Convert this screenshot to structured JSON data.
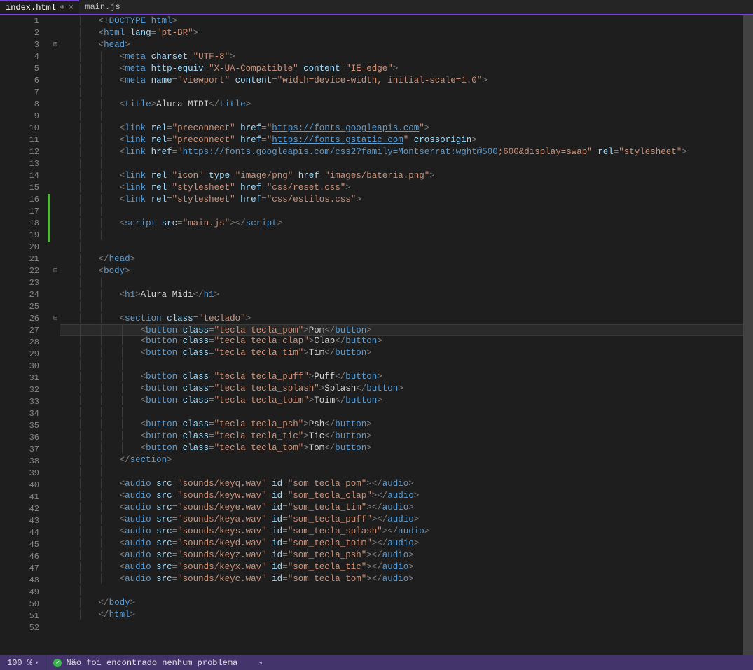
{
  "tabs": [
    {
      "label": "index.html",
      "active": true,
      "pinned": true,
      "closeable": true
    },
    {
      "label": "main.js",
      "active": false
    }
  ],
  "status": {
    "zoom": "100 %",
    "problems_text": "Não foi encontrado nenhum problema"
  },
  "current_line": 27,
  "lines": [
    {
      "n": 1,
      "t": [
        "<!",
        "DOCTYPE",
        " html",
        ">"
      ],
      "c": [
        "pun",
        "doctype",
        "tag",
        "pun"
      ],
      "i": 2
    },
    {
      "n": 2,
      "t": [
        "<",
        "html",
        " lang",
        "=",
        "\"pt-BR\"",
        ">"
      ],
      "c": [
        "pun",
        "tag",
        "attr",
        "pun",
        "str",
        "pun"
      ],
      "i": 2
    },
    {
      "n": 3,
      "t": [
        "<",
        "head",
        ">"
      ],
      "c": [
        "pun",
        "tag",
        "pun"
      ],
      "i": 2,
      "fold": "⊟"
    },
    {
      "n": 4,
      "t": [
        "<",
        "meta",
        " charset",
        "=",
        "\"UTF-8\"",
        ">"
      ],
      "c": [
        "pun",
        "tag",
        "attr",
        "pun",
        "str",
        "pun"
      ],
      "i": 3
    },
    {
      "n": 5,
      "t": [
        "<",
        "meta",
        " http-equiv",
        "=",
        "\"X-UA-Compatible\"",
        " content",
        "=",
        "\"IE=edge\"",
        ">"
      ],
      "c": [
        "pun",
        "tag",
        "attr",
        "pun",
        "str",
        "attr",
        "pun",
        "str",
        "pun"
      ],
      "i": 3
    },
    {
      "n": 6,
      "t": [
        "<",
        "meta",
        " name",
        "=",
        "\"viewport\"",
        " content",
        "=",
        "\"width=device-width, initial-scale=1.0\"",
        ">"
      ],
      "c": [
        "pun",
        "tag",
        "attr",
        "pun",
        "str",
        "attr",
        "pun",
        "str",
        "pun"
      ],
      "i": 3
    },
    {
      "n": 7,
      "t": [
        ""
      ],
      "c": [
        "txt"
      ],
      "i": 3
    },
    {
      "n": 8,
      "t": [
        "<",
        "title",
        ">",
        "Alura MIDI",
        "</",
        "title",
        ">"
      ],
      "c": [
        "pun",
        "tag",
        "pun",
        "txt",
        "pun",
        "tag",
        "pun"
      ],
      "i": 3
    },
    {
      "n": 9,
      "t": [
        ""
      ],
      "c": [
        "txt"
      ],
      "i": 3
    },
    {
      "n": 10,
      "t": [
        "<",
        "link",
        " rel",
        "=",
        "\"preconnect\"",
        " href",
        "=",
        "\"",
        "https://fonts.googleapis.com",
        "\"",
        ">"
      ],
      "c": [
        "pun",
        "tag",
        "attr",
        "pun",
        "str",
        "attr",
        "pun",
        "str",
        "url",
        "str",
        "pun"
      ],
      "i": 3
    },
    {
      "n": 11,
      "t": [
        "<",
        "link",
        " rel",
        "=",
        "\"preconnect\"",
        " href",
        "=",
        "\"",
        "https://fonts.gstatic.com",
        "\"",
        " crossorigin",
        ">"
      ],
      "c": [
        "pun",
        "tag",
        "attr",
        "pun",
        "str",
        "attr",
        "pun",
        "str",
        "url",
        "str",
        "attr",
        "pun"
      ],
      "i": 3
    },
    {
      "n": 12,
      "t": [
        "<",
        "link",
        " href",
        "=",
        "\"",
        "https://fonts.googleapis.com/css2?family=Montserrat:wght@500",
        ";600&display=swap\"",
        " rel",
        "=",
        "\"stylesheet\"",
        ">"
      ],
      "c": [
        "pun",
        "tag",
        "attr",
        "pun",
        "str",
        "url",
        "str",
        "attr",
        "pun",
        "str",
        "pun"
      ],
      "i": 3
    },
    {
      "n": 13,
      "t": [
        ""
      ],
      "c": [
        "txt"
      ],
      "i": 3
    },
    {
      "n": 14,
      "t": [
        "<",
        "link",
        " rel",
        "=",
        "\"icon\"",
        " type",
        "=",
        "\"image/png\"",
        " href",
        "=",
        "\"images/bateria.png\"",
        ">"
      ],
      "c": [
        "pun",
        "tag",
        "attr",
        "pun",
        "str",
        "attr",
        "pun",
        "str",
        "attr",
        "pun",
        "str",
        "pun"
      ],
      "i": 3
    },
    {
      "n": 15,
      "t": [
        "<",
        "link",
        " rel",
        "=",
        "\"stylesheet\"",
        " href",
        "=",
        "\"css/reset.css\"",
        ">"
      ],
      "c": [
        "pun",
        "tag",
        "attr",
        "pun",
        "str",
        "attr",
        "pun",
        "str",
        "pun"
      ],
      "i": 3
    },
    {
      "n": 16,
      "t": [
        "<",
        "link",
        " rel",
        "=",
        "\"stylesheet\"",
        " href",
        "=",
        "\"css/estilos.css\"",
        ">"
      ],
      "c": [
        "pun",
        "tag",
        "attr",
        "pun",
        "str",
        "attr",
        "pun",
        "str",
        "pun"
      ],
      "i": 3,
      "added": true
    },
    {
      "n": 17,
      "t": [
        ""
      ],
      "c": [
        "txt"
      ],
      "i": 3,
      "added": true
    },
    {
      "n": 18,
      "t": [
        "<",
        "script",
        " src",
        "=",
        "\"main.js\"",
        ">",
        "</",
        "script",
        ">"
      ],
      "c": [
        "pun",
        "tag",
        "attr",
        "pun",
        "str",
        "pun",
        "pun",
        "tag",
        "pun"
      ],
      "i": 3,
      "added": true
    },
    {
      "n": 19,
      "t": [
        ""
      ],
      "c": [
        "txt"
      ],
      "i": 3,
      "added": true
    },
    {
      "n": 20,
      "t": [
        ""
      ],
      "c": [
        "txt"
      ],
      "i": 2
    },
    {
      "n": 21,
      "t": [
        "</",
        "head",
        ">"
      ],
      "c": [
        "pun",
        "tag",
        "pun"
      ],
      "i": 2
    },
    {
      "n": 22,
      "t": [
        "<",
        "body",
        ">"
      ],
      "c": [
        "pun",
        "tag",
        "pun"
      ],
      "i": 2,
      "fold": "⊟"
    },
    {
      "n": 23,
      "t": [
        ""
      ],
      "c": [
        "txt"
      ],
      "i": 3
    },
    {
      "n": 24,
      "t": [
        "<",
        "h1",
        ">",
        "Alura Midi",
        "</",
        "h1",
        ">"
      ],
      "c": [
        "pun",
        "tag",
        "pun",
        "txt",
        "pun",
        "tag",
        "pun"
      ],
      "i": 3
    },
    {
      "n": 25,
      "t": [
        ""
      ],
      "c": [
        "txt"
      ],
      "i": 3
    },
    {
      "n": 26,
      "t": [
        "<",
        "section",
        " class",
        "=",
        "\"teclado\"",
        ">"
      ],
      "c": [
        "pun",
        "tag",
        "attr",
        "pun",
        "str",
        "pun"
      ],
      "i": 3,
      "fold": "⊟"
    },
    {
      "n": 27,
      "t": [
        "<",
        "button",
        " class",
        "=",
        "\"tecla tecla_pom\"",
        ">",
        "Pom",
        "</",
        "button",
        ">"
      ],
      "c": [
        "pun",
        "tag",
        "attr",
        "pun",
        "str",
        "pun",
        "txt",
        "pun",
        "tag",
        "pun"
      ],
      "i": 4,
      "current": true
    },
    {
      "n": 28,
      "t": [
        "<",
        "button",
        " class",
        "=",
        "\"tecla tecla_clap\"",
        ">",
        "Clap",
        "</",
        "button",
        ">"
      ],
      "c": [
        "pun",
        "tag",
        "attr",
        "pun",
        "str",
        "pun",
        "txt",
        "pun",
        "tag",
        "pun"
      ],
      "i": 4
    },
    {
      "n": 29,
      "t": [
        "<",
        "button",
        " class",
        "=",
        "\"tecla tecla_tim\"",
        ">",
        "Tim",
        "</",
        "button",
        ">"
      ],
      "c": [
        "pun",
        "tag",
        "attr",
        "pun",
        "str",
        "pun",
        "txt",
        "pun",
        "tag",
        "pun"
      ],
      "i": 4
    },
    {
      "n": 30,
      "t": [
        ""
      ],
      "c": [
        "txt"
      ],
      "i": 4
    },
    {
      "n": 31,
      "t": [
        "<",
        "button",
        " class",
        "=",
        "\"tecla tecla_puff\"",
        ">",
        "Puff",
        "</",
        "button",
        ">"
      ],
      "c": [
        "pun",
        "tag",
        "attr",
        "pun",
        "str",
        "pun",
        "txt",
        "pun",
        "tag",
        "pun"
      ],
      "i": 4
    },
    {
      "n": 32,
      "t": [
        "<",
        "button",
        " class",
        "=",
        "\"tecla tecla_splash\"",
        ">",
        "Splash",
        "</",
        "button",
        ">"
      ],
      "c": [
        "pun",
        "tag",
        "attr",
        "pun",
        "str",
        "pun",
        "txt",
        "pun",
        "tag",
        "pun"
      ],
      "i": 4
    },
    {
      "n": 33,
      "t": [
        "<",
        "button",
        " class",
        "=",
        "\"tecla tecla_toim\"",
        ">",
        "Toim",
        "</",
        "button",
        ">"
      ],
      "c": [
        "pun",
        "tag",
        "attr",
        "pun",
        "str",
        "pun",
        "txt",
        "pun",
        "tag",
        "pun"
      ],
      "i": 4
    },
    {
      "n": 34,
      "t": [
        ""
      ],
      "c": [
        "txt"
      ],
      "i": 4
    },
    {
      "n": 35,
      "t": [
        "<",
        "button",
        " class",
        "=",
        "\"tecla tecla_psh\"",
        ">",
        "Psh",
        "</",
        "button",
        ">"
      ],
      "c": [
        "pun",
        "tag",
        "attr",
        "pun",
        "str",
        "pun",
        "txt",
        "pun",
        "tag",
        "pun"
      ],
      "i": 4
    },
    {
      "n": 36,
      "t": [
        "<",
        "button",
        " class",
        "=",
        "\"tecla tecla_tic\"",
        ">",
        "Tic",
        "</",
        "button",
        ">"
      ],
      "c": [
        "pun",
        "tag",
        "attr",
        "pun",
        "str",
        "pun",
        "txt",
        "pun",
        "tag",
        "pun"
      ],
      "i": 4
    },
    {
      "n": 37,
      "t": [
        "<",
        "button",
        " class",
        "=",
        "\"tecla tecla_tom\"",
        ">",
        "Tom",
        "</",
        "button",
        ">"
      ],
      "c": [
        "pun",
        "tag",
        "attr",
        "pun",
        "str",
        "pun",
        "txt",
        "pun",
        "tag",
        "pun"
      ],
      "i": 4
    },
    {
      "n": 38,
      "t": [
        "</",
        "section",
        ">"
      ],
      "c": [
        "pun",
        "tag",
        "pun"
      ],
      "i": 3
    },
    {
      "n": 39,
      "t": [
        ""
      ],
      "c": [
        "txt"
      ],
      "i": 3
    },
    {
      "n": 40,
      "t": [
        "<",
        "audio",
        " src",
        "=",
        "\"sounds/keyq.wav\"",
        " id",
        "=",
        "\"som_tecla_pom\"",
        ">",
        "</",
        "audio",
        ">"
      ],
      "c": [
        "pun",
        "tag",
        "attr",
        "pun",
        "str",
        "attr",
        "pun",
        "str",
        "pun",
        "pun",
        "tag",
        "pun"
      ],
      "i": 3
    },
    {
      "n": 41,
      "t": [
        "<",
        "audio",
        " src",
        "=",
        "\"sounds/keyw.wav\"",
        " id",
        "=",
        "\"som_tecla_clap\"",
        ">",
        "</",
        "audio",
        ">"
      ],
      "c": [
        "pun",
        "tag",
        "attr",
        "pun",
        "str",
        "attr",
        "pun",
        "str",
        "pun",
        "pun",
        "tag",
        "pun"
      ],
      "i": 3
    },
    {
      "n": 42,
      "t": [
        "<",
        "audio",
        " src",
        "=",
        "\"sounds/keye.wav\"",
        " id",
        "=",
        "\"som_tecla_tim\"",
        ">",
        "</",
        "audio",
        ">"
      ],
      "c": [
        "pun",
        "tag",
        "attr",
        "pun",
        "str",
        "attr",
        "pun",
        "str",
        "pun",
        "pun",
        "tag",
        "pun"
      ],
      "i": 3
    },
    {
      "n": 43,
      "t": [
        "<",
        "audio",
        " src",
        "=",
        "\"sounds/keya.wav\"",
        " id",
        "=",
        "\"som_tecla_puff\"",
        ">",
        "</",
        "audio",
        ">"
      ],
      "c": [
        "pun",
        "tag",
        "attr",
        "pun",
        "str",
        "attr",
        "pun",
        "str",
        "pun",
        "pun",
        "tag",
        "pun"
      ],
      "i": 3
    },
    {
      "n": 44,
      "t": [
        "<",
        "audio",
        " src",
        "=",
        "\"sounds/keys.wav\"",
        " id",
        "=",
        "\"som_tecla_splash\"",
        ">",
        "</",
        "audio",
        ">"
      ],
      "c": [
        "pun",
        "tag",
        "attr",
        "pun",
        "str",
        "attr",
        "pun",
        "str",
        "pun",
        "pun",
        "tag",
        "pun"
      ],
      "i": 3
    },
    {
      "n": 45,
      "t": [
        "<",
        "audio",
        " src",
        "=",
        "\"sounds/keyd.wav\"",
        " id",
        "=",
        "\"som_tecla_toim\"",
        ">",
        "</",
        "audio",
        ">"
      ],
      "c": [
        "pun",
        "tag",
        "attr",
        "pun",
        "str",
        "attr",
        "pun",
        "str",
        "pun",
        "pun",
        "tag",
        "pun"
      ],
      "i": 3
    },
    {
      "n": 46,
      "t": [
        "<",
        "audio",
        " src",
        "=",
        "\"sounds/keyz.wav\"",
        " id",
        "=",
        "\"som_tecla_psh\"",
        ">",
        "</",
        "audio",
        ">"
      ],
      "c": [
        "pun",
        "tag",
        "attr",
        "pun",
        "str",
        "attr",
        "pun",
        "str",
        "pun",
        "pun",
        "tag",
        "pun"
      ],
      "i": 3
    },
    {
      "n": 47,
      "t": [
        "<",
        "audio",
        " src",
        "=",
        "\"sounds/keyx.wav\"",
        " id",
        "=",
        "\"som_tecla_tic\"",
        ">",
        "</",
        "audio",
        ">"
      ],
      "c": [
        "pun",
        "tag",
        "attr",
        "pun",
        "str",
        "attr",
        "pun",
        "str",
        "pun",
        "pun",
        "tag",
        "pun"
      ],
      "i": 3
    },
    {
      "n": 48,
      "t": [
        "<",
        "audio",
        " src",
        "=",
        "\"sounds/keyc.wav\"",
        " id",
        "=",
        "\"som_tecla_tom\"",
        ">",
        "</",
        "audio",
        ">"
      ],
      "c": [
        "pun",
        "tag",
        "attr",
        "pun",
        "str",
        "attr",
        "pun",
        "str",
        "pun",
        "pun",
        "tag",
        "pun"
      ],
      "i": 3
    },
    {
      "n": 49,
      "t": [
        ""
      ],
      "c": [
        "txt"
      ],
      "i": 2
    },
    {
      "n": 50,
      "t": [
        "</",
        "body",
        ">"
      ],
      "c": [
        "pun",
        "tag",
        "pun"
      ],
      "i": 2
    },
    {
      "n": 51,
      "t": [
        "</",
        "html",
        ">"
      ],
      "c": [
        "pun",
        "tag",
        "pun"
      ],
      "i": 2
    },
    {
      "n": 52,
      "t": [
        ""
      ],
      "c": [
        "txt"
      ],
      "i": 0
    }
  ]
}
